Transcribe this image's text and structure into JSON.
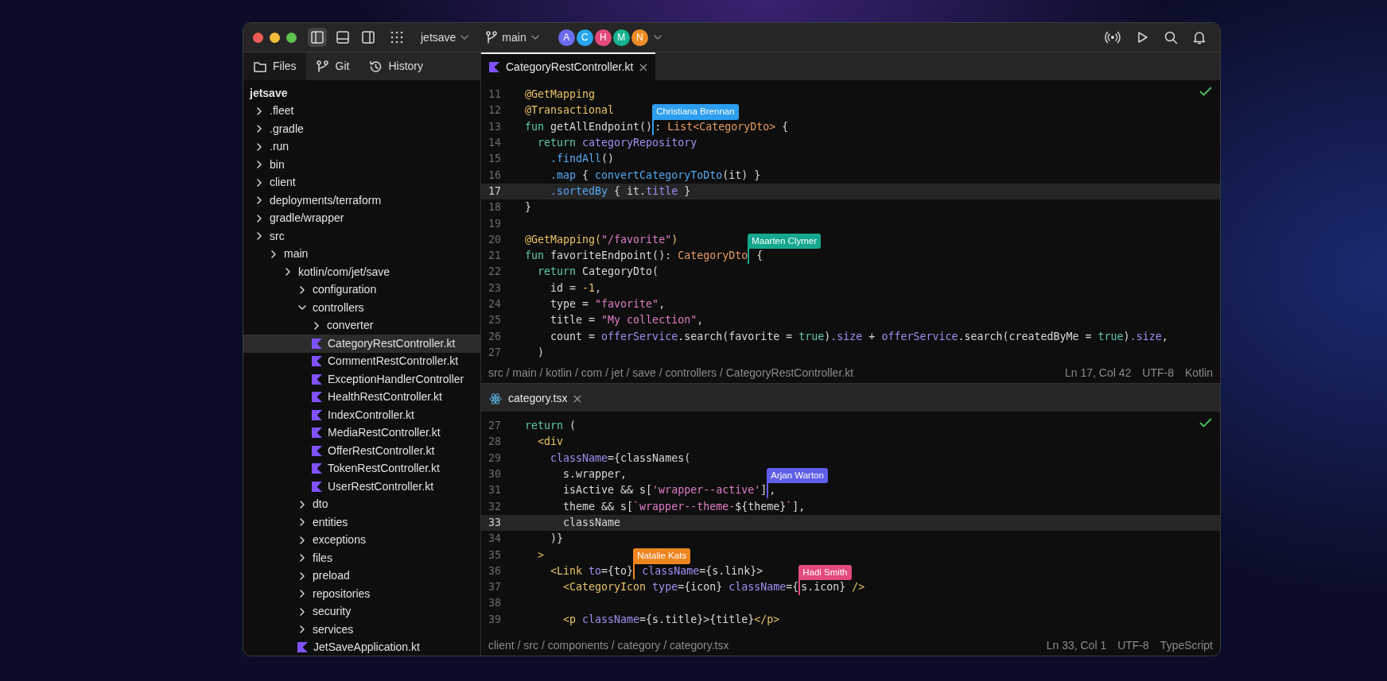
{
  "title_bar": {
    "layout_toggles": [
      {
        "kind": "left-panel",
        "selected": true
      },
      {
        "kind": "bottom-panel",
        "selected": false
      },
      {
        "kind": "right-panel",
        "selected": false
      }
    ],
    "project": "jetsave",
    "branch": "main",
    "avatars": [
      {
        "letter": "A",
        "color": "#6b6cf0"
      },
      {
        "letter": "C",
        "color": "#27a6ef"
      },
      {
        "letter": "H",
        "color": "#e64a7d"
      },
      {
        "letter": "M",
        "color": "#17b393"
      },
      {
        "letter": "N",
        "color": "#f08c25"
      }
    ]
  },
  "sidebar": {
    "tabs": [
      {
        "label": "Files",
        "kind": "files",
        "selected": true
      },
      {
        "label": "Git",
        "kind": "git",
        "selected": false
      },
      {
        "label": "History",
        "kind": "history",
        "selected": false
      }
    ],
    "root": "jetsave",
    "tree": [
      {
        "label": ".fleet",
        "kind": "folder",
        "expanded": false,
        "selected": false
      },
      {
        "label": ".gradle",
        "kind": "folder",
        "expanded": false,
        "selected": false
      },
      {
        "label": ".run",
        "kind": "folder",
        "expanded": false,
        "selected": false
      },
      {
        "label": "bin",
        "kind": "folder",
        "expanded": false,
        "selected": false
      },
      {
        "label": "client",
        "kind": "folder",
        "expanded": false,
        "selected": false
      },
      {
        "label": "deployments/terraform",
        "kind": "folder",
        "expanded": false,
        "selected": false
      },
      {
        "label": "gradle/wrapper",
        "kind": "folder",
        "expanded": false,
        "selected": false
      },
      {
        "label": "src",
        "kind": "folder",
        "expanded": false,
        "selected": false,
        "children": [
          {
            "label": "main",
            "kind": "folder",
            "expanded": false,
            "selected": false,
            "children": [
              {
                "label": "kotlin/com/jet/save",
                "kind": "folder",
                "expanded": false,
                "selected": false,
                "children": [
                  {
                    "label": "configuration",
                    "kind": "folder",
                    "expanded": false,
                    "selected": false
                  },
                  {
                    "label": "controllers",
                    "kind": "folder",
                    "expanded": true,
                    "selected": false,
                    "children": [
                      {
                        "label": "converter",
                        "kind": "folder",
                        "expanded": false,
                        "selected": false
                      },
                      {
                        "label": "CategoryRestController.kt",
                        "kind": "kotlin",
                        "selected": true
                      },
                      {
                        "label": "CommentRestController.kt",
                        "kind": "kotlin",
                        "selected": false
                      },
                      {
                        "label": "ExceptionHandlerController",
                        "kind": "kotlin",
                        "selected": false
                      },
                      {
                        "label": "HealthRestController.kt",
                        "kind": "kotlin",
                        "selected": false
                      },
                      {
                        "label": "IndexController.kt",
                        "kind": "kotlin",
                        "selected": false
                      },
                      {
                        "label": "MediaRestController.kt",
                        "kind": "kotlin",
                        "selected": false
                      },
                      {
                        "label": "OfferRestController.kt",
                        "kind": "kotlin",
                        "selected": false
                      },
                      {
                        "label": "TokenRestController.kt",
                        "kind": "kotlin",
                        "selected": false
                      },
                      {
                        "label": "UserRestController.kt",
                        "kind": "kotlin",
                        "selected": false
                      }
                    ]
                  },
                  {
                    "label": "dto",
                    "kind": "folder",
                    "expanded": false,
                    "selected": false
                  },
                  {
                    "label": "entities",
                    "kind": "folder",
                    "expanded": false,
                    "selected": false
                  },
                  {
                    "label": "exceptions",
                    "kind": "folder",
                    "expanded": false,
                    "selected": false
                  },
                  {
                    "label": "files",
                    "kind": "folder",
                    "expanded": false,
                    "selected": false
                  },
                  {
                    "label": "preload",
                    "kind": "folder",
                    "expanded": false,
                    "selected": false
                  },
                  {
                    "label": "repositories",
                    "kind": "folder",
                    "expanded": false,
                    "selected": false
                  },
                  {
                    "label": "security",
                    "kind": "folder",
                    "expanded": false,
                    "selected": false
                  },
                  {
                    "label": "services",
                    "kind": "folder",
                    "expanded": false,
                    "selected": false
                  },
                  {
                    "label": "JetSaveApplication.kt",
                    "kind": "kotlin",
                    "selected": false
                  }
                ]
              }
            ]
          }
        ]
      }
    ]
  },
  "editors": [
    {
      "tab": {
        "label": "CategoryRestController.kt",
        "kind": "kotlin",
        "selected": true
      },
      "lines": [
        {
          "number": "11",
          "highlighted": false,
          "tokens": [
            {
              "kind": "ann",
              "text": "@GetMapping"
            }
          ]
        },
        {
          "number": "12",
          "highlighted": false,
          "tokens": [
            {
              "kind": "ann",
              "text": "@Transactional"
            }
          ]
        },
        {
          "number": "13",
          "highlighted": false,
          "tokens": [
            {
              "kind": "kw",
              "text": "fun"
            },
            {
              "kind": "plain",
              "text": " getAllEndpoint()"
            },
            {
              "kind": "cursor",
              "name": "Christiana Brennan",
              "color": "#2d9ef0"
            },
            {
              "kind": "plain",
              "text": ": "
            },
            {
              "kind": "type",
              "text": "List<CategoryDto>"
            },
            {
              "kind": "plain",
              "text": " {"
            }
          ]
        },
        {
          "number": "14",
          "highlighted": false,
          "tokens": [
            {
              "kind": "kw",
              "text": "  return"
            },
            {
              "kind": "prop",
              "text": " categoryRepository"
            }
          ]
        },
        {
          "number": "15",
          "highlighted": false,
          "tokens": [
            {
              "kind": "fn",
              "text": "    .findAll"
            },
            {
              "kind": "plain",
              "text": "()"
            }
          ]
        },
        {
          "number": "16",
          "highlighted": false,
          "tokens": [
            {
              "kind": "fn",
              "text": "    .map"
            },
            {
              "kind": "plain",
              "text": " { "
            },
            {
              "kind": "fn",
              "text": "convertCategoryToDto"
            },
            {
              "kind": "plain",
              "text": "(it) }"
            }
          ]
        },
        {
          "number": "17",
          "highlighted": true,
          "tokens": [
            {
              "kind": "fn",
              "text": "    .sortedBy"
            },
            {
              "kind": "plain",
              "text": " { it."
            },
            {
              "kind": "prop",
              "text": "title"
            },
            {
              "kind": "plain",
              "text": " }"
            }
          ]
        },
        {
          "number": "18",
          "highlighted": false,
          "tokens": [
            {
              "kind": "plain",
              "text": "}"
            }
          ]
        },
        {
          "number": "19",
          "highlighted": false
        },
        {
          "number": "20",
          "highlighted": false,
          "tokens": [
            {
              "kind": "ann",
              "text": "@GetMapping("
            },
            {
              "kind": "str",
              "text": "\"/favorite\""
            },
            {
              "kind": "ann",
              "text": ")"
            }
          ]
        },
        {
          "number": "21",
          "highlighted": false,
          "tokens": [
            {
              "kind": "kw",
              "text": "fun"
            },
            {
              "kind": "plain",
              "text": " favoriteEndpoint(): "
            },
            {
              "kind": "type",
              "text": "CategoryDto"
            },
            {
              "kind": "cursor",
              "name": "Maarten Clymer",
              "color": "#15a88e"
            },
            {
              "kind": "plain",
              "text": " {"
            }
          ]
        },
        {
          "number": "22",
          "highlighted": false,
          "tokens": [
            {
              "kind": "kw",
              "text": "  return"
            },
            {
              "kind": "plain",
              "text": " CategoryDto("
            }
          ]
        },
        {
          "number": "23",
          "highlighted": false,
          "tokens": [
            {
              "kind": "plain",
              "text": "    id = "
            },
            {
              "kind": "num",
              "text": "-1"
            },
            {
              "kind": "plain",
              "text": ","
            }
          ]
        },
        {
          "number": "24",
          "highlighted": false,
          "tokens": [
            {
              "kind": "plain",
              "text": "    type = "
            },
            {
              "kind": "str",
              "text": "\"favorite\""
            },
            {
              "kind": "plain",
              "text": ","
            }
          ]
        },
        {
          "number": "25",
          "highlighted": false,
          "tokens": [
            {
              "kind": "plain",
              "text": "    title = "
            },
            {
              "kind": "str",
              "text": "\"My collection\""
            },
            {
              "kind": "plain",
              "text": ","
            }
          ]
        },
        {
          "number": "26",
          "highlighted": false,
          "tokens": [
            {
              "kind": "plain",
              "text": "    count = "
            },
            {
              "kind": "prop",
              "text": "offerService"
            },
            {
              "kind": "plain",
              "text": ".search(favorite = "
            },
            {
              "kind": "kw",
              "text": "true"
            },
            {
              "kind": "plain",
              "text": ")"
            },
            {
              "kind": "prop",
              "text": ".size"
            },
            {
              "kind": "plain",
              "text": " + "
            },
            {
              "kind": "prop",
              "text": "offerService"
            },
            {
              "kind": "plain",
              "text": ".search(createdByMe = "
            },
            {
              "kind": "kw",
              "text": "true"
            },
            {
              "kind": "plain",
              "text": ")"
            },
            {
              "kind": "prop",
              "text": ".size"
            },
            {
              "kind": "plain",
              "text": ","
            }
          ]
        },
        {
          "number": "27",
          "highlighted": false,
          "tokens": [
            {
              "kind": "plain",
              "text": "  )"
            }
          ]
        }
      ],
      "breadcrumb": "src / main / kotlin / com / jet / save / controllers / CategoryRestController.kt",
      "position": "Ln 17, Col 42",
      "encoding": "UTF-8",
      "language": "Kotlin"
    },
    {
      "tab": {
        "label": "category.tsx",
        "kind": "react",
        "selected": false
      },
      "lines": [
        {
          "number": "27",
          "highlighted": false,
          "tokens": [
            {
              "kind": "kw",
              "text": "return"
            },
            {
              "kind": "plain",
              "text": " ("
            }
          ]
        },
        {
          "number": "28",
          "highlighted": false,
          "tokens": [
            {
              "kind": "tag",
              "text": "  <div"
            }
          ]
        },
        {
          "number": "29",
          "highlighted": false,
          "tokens": [
            {
              "kind": "attr",
              "text": "    className"
            },
            {
              "kind": "plain",
              "text": "={classNames("
            }
          ]
        },
        {
          "number": "30",
          "highlighted": false,
          "tokens": [
            {
              "kind": "plain",
              "text": "      s.wrapper,"
            }
          ]
        },
        {
          "number": "31",
          "highlighted": false,
          "tokens": [
            {
              "kind": "plain",
              "text": "      isActive && s["
            },
            {
              "kind": "str",
              "text": "'wrapper--active'"
            },
            {
              "kind": "plain",
              "text": "]"
            },
            {
              "kind": "cursor",
              "name": "Arjan Warton",
              "color": "#5f5fe8"
            },
            {
              "kind": "plain",
              "text": ","
            }
          ]
        },
        {
          "number": "32",
          "highlighted": false,
          "tokens": [
            {
              "kind": "plain",
              "text": "      theme && s["
            },
            {
              "kind": "str",
              "text": "`wrapper--theme-"
            },
            {
              "kind": "plain",
              "text": "${theme}"
            },
            {
              "kind": "str",
              "text": "`"
            },
            {
              "kind": "plain",
              "text": "],"
            }
          ]
        },
        {
          "number": "33",
          "highlighted": true,
          "tokens": [
            {
              "kind": "plain",
              "text": "      className"
            }
          ]
        },
        {
          "number": "34",
          "highlighted": false,
          "tokens": [
            {
              "kind": "plain",
              "text": "    )}"
            }
          ]
        },
        {
          "number": "35",
          "highlighted": false,
          "tokens": [
            {
              "kind": "tag",
              "text": "  >"
            }
          ]
        },
        {
          "number": "36",
          "highlighted": false,
          "tokens": [
            {
              "kind": "tag",
              "text": "    <Link"
            },
            {
              "kind": "attr",
              "text": " to"
            },
            {
              "kind": "plain",
              "text": "={to}"
            },
            {
              "kind": "cursor",
              "name": "Natalie Kats",
              "color": "#ef8520"
            },
            {
              "kind": "attr",
              "text": " className"
            },
            {
              "kind": "plain",
              "text": "={s.link}>"
            }
          ]
        },
        {
          "number": "37",
          "highlighted": false,
          "tokens": [
            {
              "kind": "tag",
              "text": "      <CategoryIcon"
            },
            {
              "kind": "attr",
              "text": " type"
            },
            {
              "kind": "plain",
              "text": "={icon} "
            },
            {
              "kind": "attr",
              "text": "className"
            },
            {
              "kind": "plain",
              "text": "={"
            },
            {
              "kind": "cursor",
              "name": "Hadi Smith",
              "color": "#e34b7c"
            },
            {
              "kind": "plain",
              "text": "s.icon} "
            },
            {
              "kind": "tag",
              "text": "/>"
            }
          ]
        },
        {
          "number": "38",
          "highlighted": false
        },
        {
          "number": "39",
          "highlighted": false,
          "tokens": [
            {
              "kind": "tag",
              "text": "      <p"
            },
            {
              "kind": "attr",
              "text": " className"
            },
            {
              "kind": "plain",
              "text": "={s.title}>{title}"
            },
            {
              "kind": "tag",
              "text": "</p>"
            }
          ]
        }
      ],
      "breadcrumb": "client / src / components / category / category.tsx",
      "position": "Ln 33, Col 1",
      "encoding": "UTF-8",
      "language": "TypeScript"
    }
  ]
}
